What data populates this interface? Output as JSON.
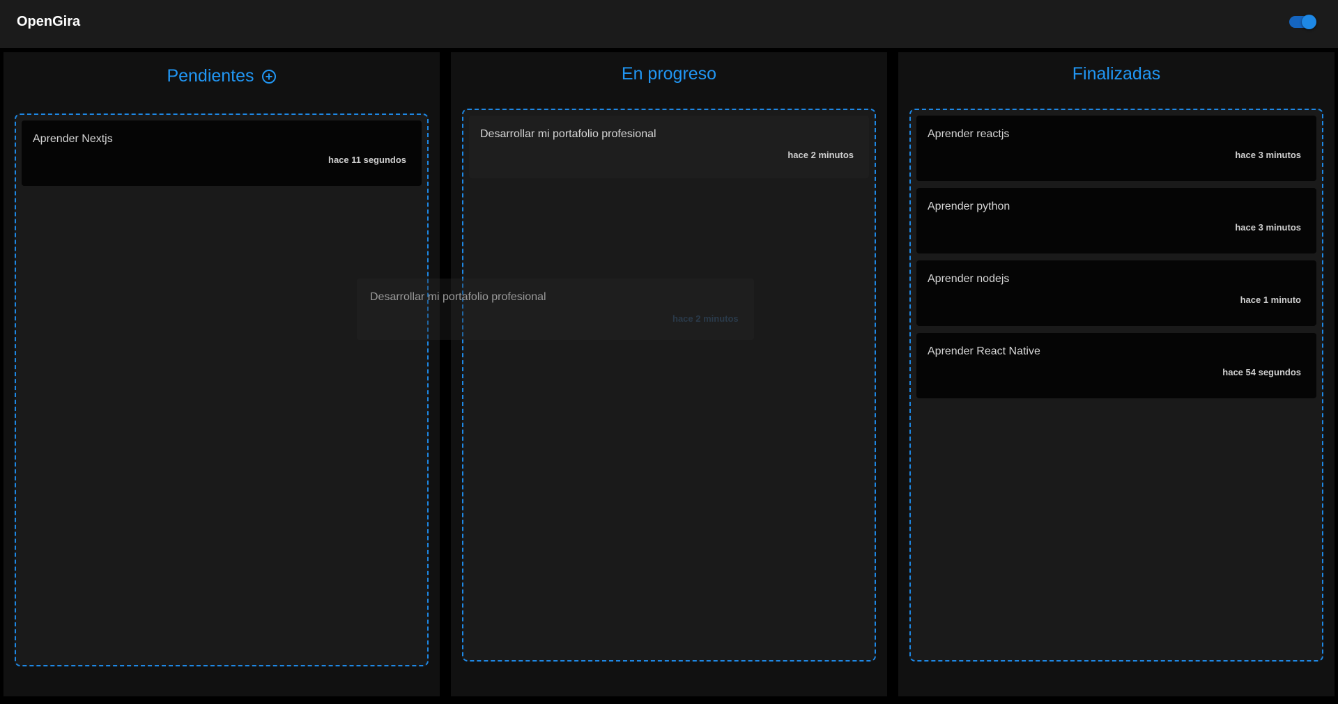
{
  "app": {
    "title": "OpenGira",
    "theme_toggle": {
      "state": "on",
      "color": "#1e88e5"
    }
  },
  "colors": {
    "accent": "#2196f3",
    "background": "#000000",
    "column_bg": "#111111",
    "dropzone_border": "#1e88e5"
  },
  "columns": [
    {
      "title": "Pendientes",
      "add_icon": "add-circle-outline-icon",
      "cards": [
        {
          "title": "Aprender Nextjs",
          "time": "hace 11 segundos"
        }
      ]
    },
    {
      "title": "En progreso",
      "cards": [
        {
          "title": "Desarrollar mi portafolio profesional",
          "time": "hace 2 minutos"
        }
      ]
    },
    {
      "title": "Finalizadas",
      "cards": [
        {
          "title": "Aprender reactjs",
          "time": "hace 3 minutos"
        },
        {
          "title": "Aprender python",
          "time": "hace 3 minutos"
        },
        {
          "title": "Aprender nodejs",
          "time": "hace 1 minuto"
        },
        {
          "title": "Aprender React Native",
          "time": "hace 54 segundos"
        }
      ]
    }
  ],
  "drag_preview": {
    "title": "Desarrollar mi portafolio profesional",
    "time": "hace 2 minutos"
  }
}
